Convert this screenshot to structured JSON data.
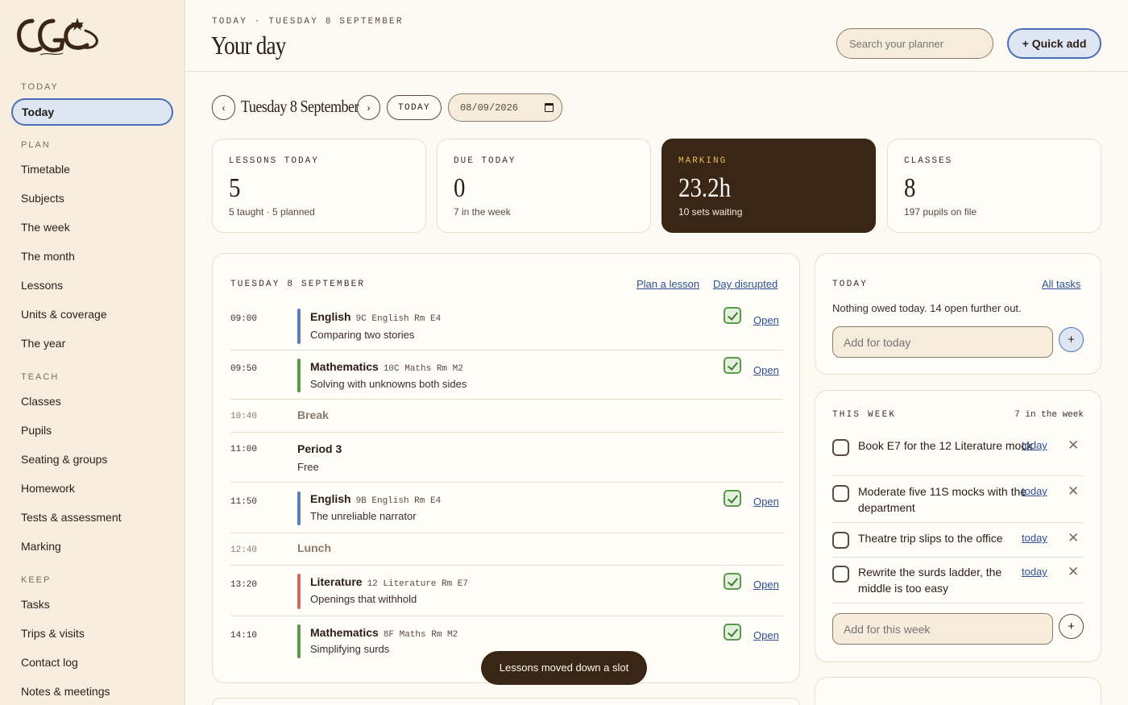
{
  "sidebar": {
    "sections": {
      "today": "TODAY",
      "plan": "PLAN",
      "teach": "TEACH",
      "keep": "KEEP"
    },
    "active_item": "Today",
    "plan_items": [
      "Timetable",
      "Subjects",
      "The week",
      "The month",
      "Lessons",
      "Units & coverage",
      "The year"
    ],
    "teach_items": [
      "Classes",
      "Pupils",
      "Seating & groups",
      "Homework",
      "Tests & assessment",
      "Marking"
    ],
    "keep_items": [
      "Tasks",
      "Trips & visits",
      "Contact log",
      "Notes & meetings"
    ]
  },
  "header": {
    "breadcrumb": "TODAY · TUESDAY 8 SEPTEMBER",
    "title": "Your day",
    "search_placeholder": "Search your planner",
    "quick_add_label": "+ Quick add"
  },
  "date_nav": {
    "prev": "‹",
    "next": "›",
    "label": "Tuesday 8 September",
    "today_label": "TODAY",
    "date_value": "08/09/2026"
  },
  "stats": [
    {
      "label": "LESSONS TODAY",
      "value": "5",
      "sub": "5 taught · 5 planned"
    },
    {
      "label": "DUE TODAY",
      "value": "0",
      "sub": "7 in the week"
    },
    {
      "label": "MARKING",
      "value": "23.2h",
      "sub": "10 sets waiting"
    },
    {
      "label": "CLASSES",
      "value": "8",
      "sub": "197 pupils on file"
    }
  ],
  "schedule": {
    "title": "TUESDAY 8 SEPTEMBER",
    "plan_link": "Plan a lesson",
    "disrupted_link": "Day disrupted",
    "open_label": "Open",
    "lessons": [
      {
        "time": "09:00",
        "subject": "English",
        "meta": "9C English Rm E4",
        "desc": "Comparing two stories"
      },
      {
        "time": "09:50",
        "subject": "Mathematics",
        "meta": "10C Maths Rm M2",
        "desc": "Solving with unknowns both sides"
      },
      {
        "time": "10:40",
        "break_label": "Break"
      },
      {
        "time": "11:00",
        "subject": "Period 3",
        "desc": "Free"
      },
      {
        "time": "11:50",
        "subject": "English",
        "meta": "9B English Rm E4",
        "desc": "The unreliable narrator"
      },
      {
        "time": "12:40",
        "break_label": "Lunch"
      },
      {
        "time": "13:20",
        "subject": "Literature",
        "meta": "12 Literature Rm E7",
        "desc": "Openings that withhold"
      },
      {
        "time": "14:10",
        "subject": "Mathematics",
        "meta": "8F Maths Rm M2",
        "desc": "Simplifying surds"
      }
    ]
  },
  "toast": "Lessons moved down a slot",
  "today_panel": {
    "title": "TODAY",
    "link": "All tasks",
    "message": "Nothing owed today. 14 open further out.",
    "add_placeholder": "Add for today",
    "add_button": "+"
  },
  "week_panel": {
    "title": "THIS WEEK",
    "count": "7 in the week",
    "tasks": [
      {
        "text": "Book E7 for the 12 Literature mock",
        "link": "today"
      },
      {
        "text": "Moderate five 11S mocks with the department",
        "link": "today"
      },
      {
        "text": "Theatre trip slips to the office",
        "link": "today"
      },
      {
        "text": "Rewrite the surds ladder, the middle is too easy",
        "link": "today"
      }
    ],
    "add_placeholder": "Add for this week",
    "add_button": "+",
    "remove_glyph": "✕"
  },
  "colors": {
    "accent_blue": "#4a6fb8",
    "english": "#5b7fc4",
    "maths": "#5a9a4b",
    "literature": "#d06a60",
    "dark_card": "#3a2615",
    "marking_label": "#e5bc5c"
  }
}
